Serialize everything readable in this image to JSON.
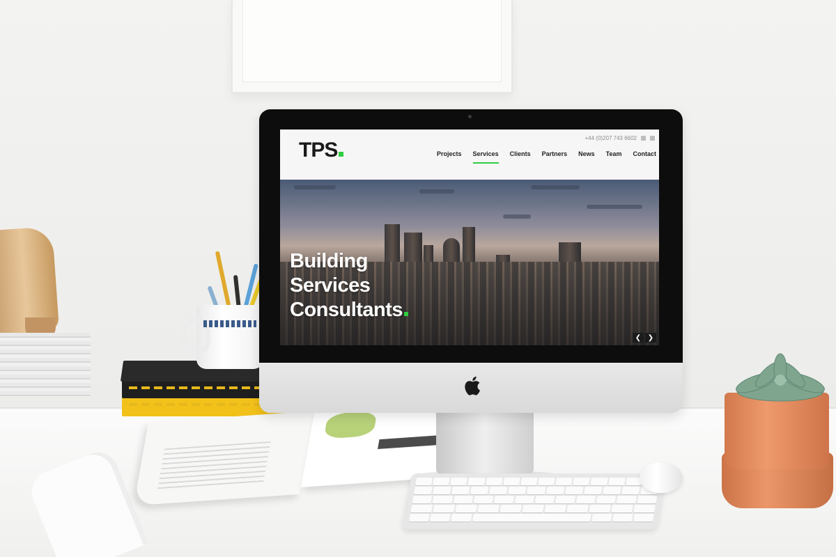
{
  "website": {
    "logo": "TPS",
    "phone": "+44 (0)207 743 6602",
    "nav": [
      {
        "label": "Projects",
        "active": false
      },
      {
        "label": "Services",
        "active": true
      },
      {
        "label": "Clients",
        "active": false
      },
      {
        "label": "Partners",
        "active": false
      },
      {
        "label": "News",
        "active": false
      },
      {
        "label": "Team",
        "active": false
      },
      {
        "label": "Contact",
        "active": false
      }
    ],
    "hero": {
      "headline_lines": [
        "Building",
        "Services",
        "Consultants"
      ],
      "prev_arrow": "❮",
      "next_arrow": "❯"
    }
  },
  "colors": {
    "accent": "#2ecc40",
    "text_dark": "#1a1a1a",
    "bezel": "#0d0d0d",
    "header_bg": "#f6f6f6"
  },
  "icons": {
    "apple_logo": "apple-logo-icon",
    "social_1": "social-icon",
    "social_2": "social-icon"
  }
}
